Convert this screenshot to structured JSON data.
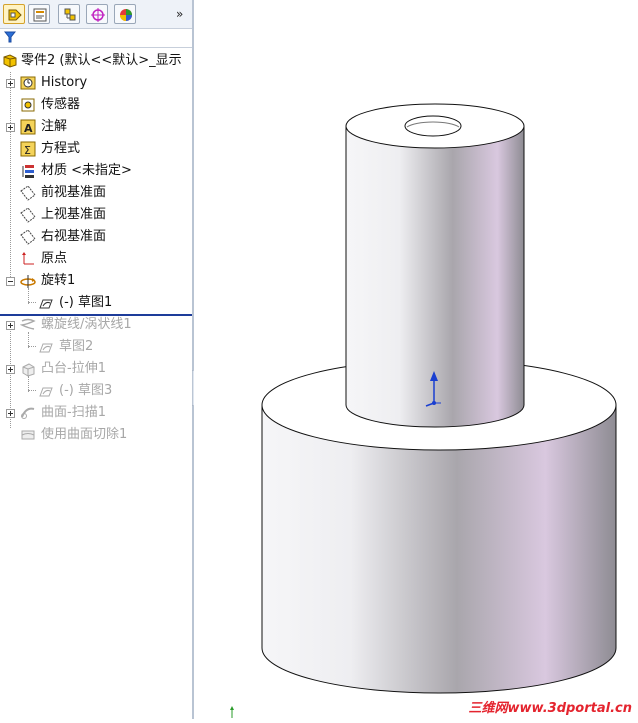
{
  "tabs": [
    {
      "name": "featuremanager",
      "icon": "feature-tree-icon"
    },
    {
      "name": "propertymanager",
      "icon": "property-icon"
    },
    {
      "name": "configurationmanager",
      "icon": "configuration-icon"
    },
    {
      "name": "dimxpert",
      "icon": "dimxpert-icon"
    },
    {
      "name": "display-manager",
      "icon": "appearance-icon"
    }
  ],
  "more_symbol": "»",
  "tree": {
    "root": "零件2 (默认<<默认>_显示",
    "items": [
      {
        "label": "History",
        "icon": "history-icon"
      },
      {
        "label": "传感器",
        "icon": "sensor-icon"
      },
      {
        "label": "注解",
        "icon": "annotation-icon"
      },
      {
        "label": "方程式",
        "icon": "equation-icon"
      },
      {
        "label": "材质 <未指定>",
        "icon": "material-icon"
      },
      {
        "label": "前视基准面",
        "icon": "plane-icon"
      },
      {
        "label": "上视基准面",
        "icon": "plane-icon"
      },
      {
        "label": "右视基准面",
        "icon": "plane-icon"
      },
      {
        "label": "原点",
        "icon": "origin-icon"
      },
      {
        "label": "旋转1",
        "icon": "revolve-icon"
      },
      {
        "label": "(-) 草图1",
        "icon": "sketch-icon"
      },
      {
        "label": "螺旋线/涡状线1",
        "icon": "helix-icon"
      },
      {
        "label": "草图2",
        "icon": "sketch-icon"
      },
      {
        "label": "凸台-拉伸1",
        "icon": "extrude-icon"
      },
      {
        "label": "(-) 草图3",
        "icon": "sketch-icon"
      },
      {
        "label": "曲面-扫描1",
        "icon": "surface-sweep-icon"
      },
      {
        "label": "使用曲面切除1",
        "icon": "surface-cut-icon"
      }
    ]
  },
  "watermark": "三维网www.3dportal.cn",
  "colors": {
    "rollback_bar": "#1d3c9a",
    "accent": "#f2c200",
    "model_shade": "#d9c8df"
  }
}
